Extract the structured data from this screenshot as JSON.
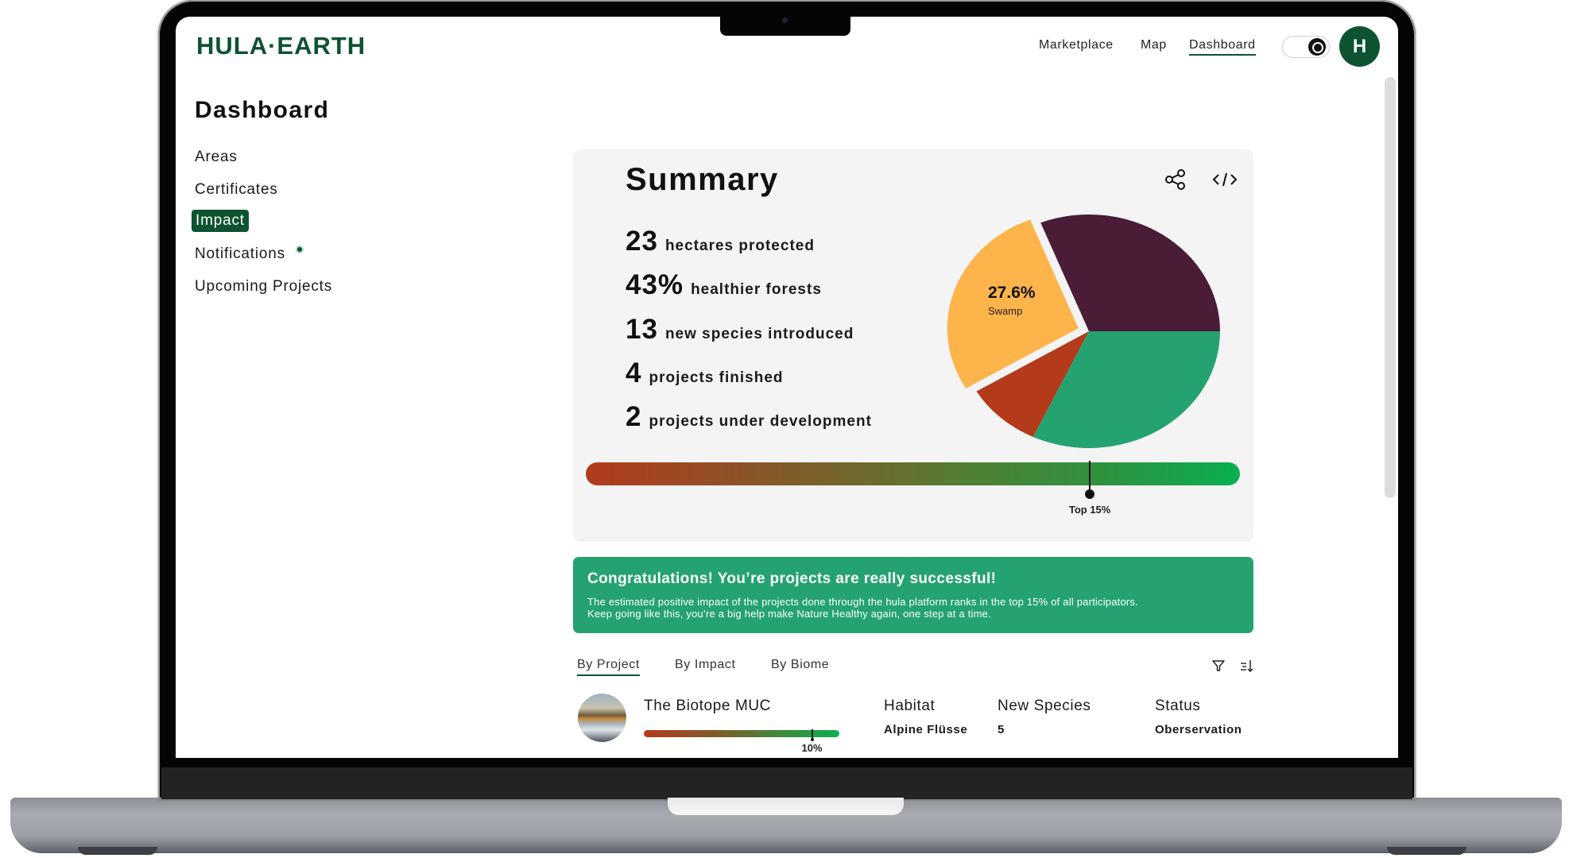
{
  "header": {
    "logo": "HULA·EARTH",
    "nav": [
      {
        "label": "Marketplace",
        "active": false
      },
      {
        "label": "Map",
        "active": false
      },
      {
        "label": "Dashboard",
        "active": true
      }
    ],
    "theme_toggle": {
      "state": "on"
    },
    "user_avatar_initial": "H"
  },
  "sidebar": {
    "title": "Dashboard",
    "items": [
      {
        "label": "Areas",
        "active": false
      },
      {
        "label": "Certificates",
        "active": false
      },
      {
        "label": "Impact",
        "active": true
      },
      {
        "label": "Notifications",
        "active": false,
        "has_dot": true
      },
      {
        "label": "Upcoming Projects",
        "active": false
      }
    ]
  },
  "summary": {
    "title": "Summary",
    "actions": [
      {
        "icon": "share-icon"
      },
      {
        "icon": "code-icon"
      }
    ],
    "stats": [
      {
        "value": "23",
        "label": "hectares protected"
      },
      {
        "value": "43%",
        "label": "healthier forests"
      },
      {
        "value": "13",
        "label": "new species introduced"
      },
      {
        "value": "4",
        "label": "projects finished"
      },
      {
        "value": "2",
        "label": "projects under development"
      }
    ],
    "impact_bar": {
      "label": "Top 15%",
      "marker_fraction": 0.78,
      "colors": {
        "start": "#b33a1c",
        "end": "#08b04f"
      }
    }
  },
  "chart_data": {
    "type": "pie",
    "title": "",
    "slices": [
      {
        "name": "",
        "value": 31.0,
        "color": "#4a1c35"
      },
      {
        "name": "Swamp",
        "value": 27.6,
        "color": "#fdb44b",
        "exploded": true,
        "label": "27.6%"
      },
      {
        "name": "",
        "value": 9.4,
        "color": "#b33a1a"
      },
      {
        "name": "",
        "value": 32.0,
        "color": "#24a370"
      }
    ],
    "highlighted": {
      "value_label": "27.6%",
      "name": "Swamp"
    }
  },
  "banner": {
    "title": "Congratulations! You’re projects are really successful!",
    "line1": "The estimated positive impact of the projects done through the hula platform ranks in the top 15% of all participators.",
    "line2": "Keep going like this, you’re a big help make Nature Healthy again, one step at a time.",
    "color": "#24a370"
  },
  "tabs": [
    {
      "label": "By Project",
      "active": true
    },
    {
      "label": "By Impact",
      "active": false
    },
    {
      "label": "By Biome",
      "active": false
    }
  ],
  "list_tools": [
    {
      "icon": "filter-icon"
    },
    {
      "icon": "sort-icon"
    }
  ],
  "projects": [
    {
      "name": "The Biotope MUC",
      "impact_label": "10%",
      "impact_marker_fraction": 0.86,
      "habitat_label": "Habitat",
      "habitat": "Alpine Flüsse",
      "species_label": "New Species",
      "species": "5",
      "status_label": "Status",
      "status": "Oberservation"
    }
  ],
  "colors": {
    "brand": "#0e5230",
    "card_bg": "#f4f4f4",
    "banner": "#24a370"
  }
}
